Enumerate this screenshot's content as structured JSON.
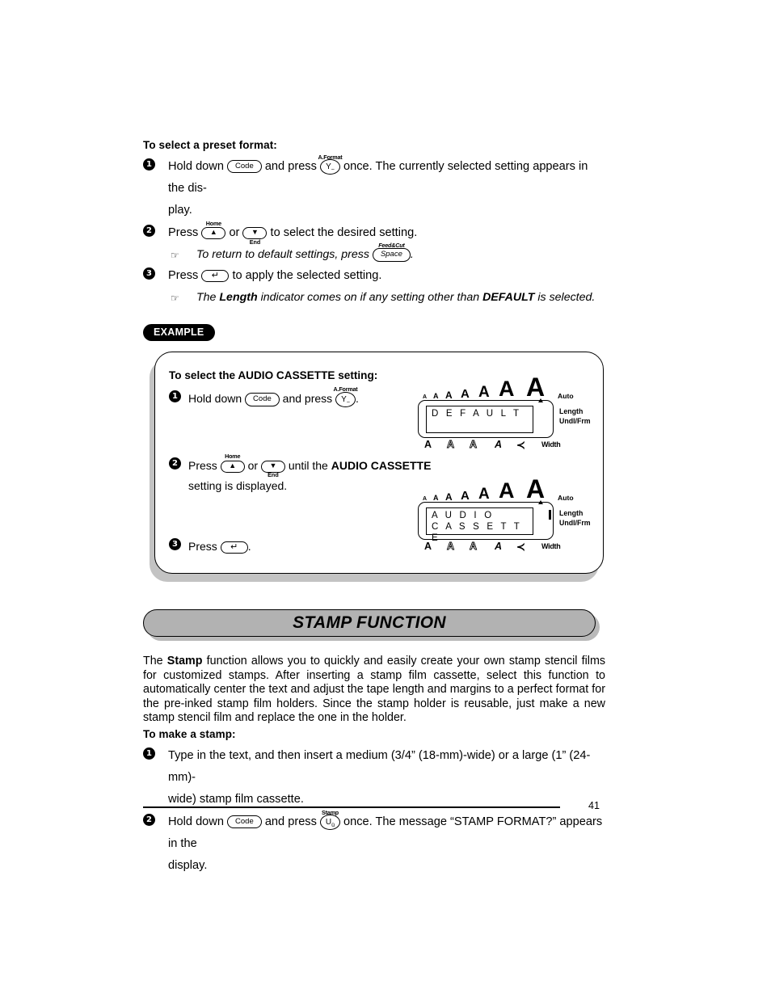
{
  "document": {
    "page_number": "41"
  },
  "section_preset": {
    "heading": "To select a preset format:",
    "step1": {
      "num": "1",
      "text_before": "Hold down",
      "key_code": "Code",
      "text_middle": "and press",
      "key_y_top": "A.Format",
      "key_y": "Y",
      "key_y_sub": "~",
      "text_after": "once. The currently selected setting appears in the dis-",
      "text_wrap": "play."
    },
    "step2": {
      "num": "2",
      "text_before": "Press",
      "key_up_top": "Home",
      "key_up": "▲",
      "text_or": "or",
      "key_down": "▼",
      "key_down_bot": "End",
      "text_after": "to select the desired setting."
    },
    "note1": {
      "icon": "☞",
      "text_before": "To return to default settings, press",
      "key_space_top": "Feed&Cut",
      "key_space": "Space",
      "text_after": "."
    },
    "step3": {
      "num": "3",
      "text_before": "Press",
      "key_enter": "↵",
      "text_after": "to apply the selected setting."
    },
    "note2": {
      "icon": "☞",
      "part1": "The ",
      "bold1": "Length",
      "part2": " indicator comes on if any setting other than ",
      "bold2": "DEFAULT",
      "part3": " is selected."
    }
  },
  "example": {
    "badge": "EXAMPLE",
    "title": "To select the AUDIO CASSETTE setting:",
    "step1": {
      "num": "1",
      "text_before": "Hold down",
      "key_code": "Code",
      "text_middle": "and press",
      "key_y_top": "A.Format",
      "key_y": "Y",
      "key_y_sub": "~",
      "text_after": "."
    },
    "step2": {
      "num": "2",
      "text_before": "Press",
      "key_up_top": "Home",
      "key_up": "▲",
      "text_or": "or",
      "key_down": "▼",
      "key_down_bot": "End",
      "text_until": "until the",
      "bold": "AUDIO CASSETTE",
      "text_wrap": "setting is displayed."
    },
    "step3": {
      "num": "3",
      "text_before": "Press",
      "key_enter": "↵",
      "text_after": "."
    },
    "lcd1": {
      "line1": "D E F A U L T",
      "line2": "",
      "auto_label": "Auto",
      "length_label": "Length",
      "undl_label": "Undl/Frm",
      "width_label": "Width",
      "length_on": false,
      "size_letters": [
        "A",
        "A",
        "A",
        "A",
        "A",
        "A",
        "A"
      ],
      "bottom_icons": [
        "A",
        "A",
        "A",
        "A",
        "≺"
      ]
    },
    "lcd2": {
      "line1": "A U D I O",
      "line2": "C A S S E T T E",
      "auto_label": "Auto",
      "length_label": "Length",
      "undl_label": "Undl/Frm",
      "width_label": "Width",
      "length_on": true,
      "size_letters": [
        "A",
        "A",
        "A",
        "A",
        "A",
        "A",
        "A"
      ],
      "bottom_icons": [
        "A",
        "A",
        "A",
        "A",
        "≺"
      ]
    }
  },
  "stamp_section": {
    "banner_title": "STAMP FUNCTION",
    "paragraph_part1": "The ",
    "paragraph_bold": "Stamp",
    "paragraph_part2": " function allows you to quickly and easily create your own stamp stencil films for customized stamps. After inserting a stamp film cassette, select this function to automatically center the text and adjust the tape length and margins to a perfect format for the pre-inked stamp film holders. Since the stamp holder is reusable, just make a new stamp stencil film and replace the one in the holder.",
    "heading": "To make a stamp:",
    "step1": {
      "num": "1",
      "text": "Type in the text, and then insert a medium (3/4” (18-mm)-wide) or a large (1” (24-mm)-",
      "text_wrap": "wide) stamp film cassette."
    },
    "step2": {
      "num": "2",
      "text_before": "Hold down",
      "key_code": "Code",
      "text_middle": "and press",
      "key_u_top": "Stamp",
      "key_u": "U",
      "key_u_sub": "ü",
      "text_after": "once. The message “STAMP FORMAT?” appears in the",
      "text_wrap": "display."
    }
  }
}
